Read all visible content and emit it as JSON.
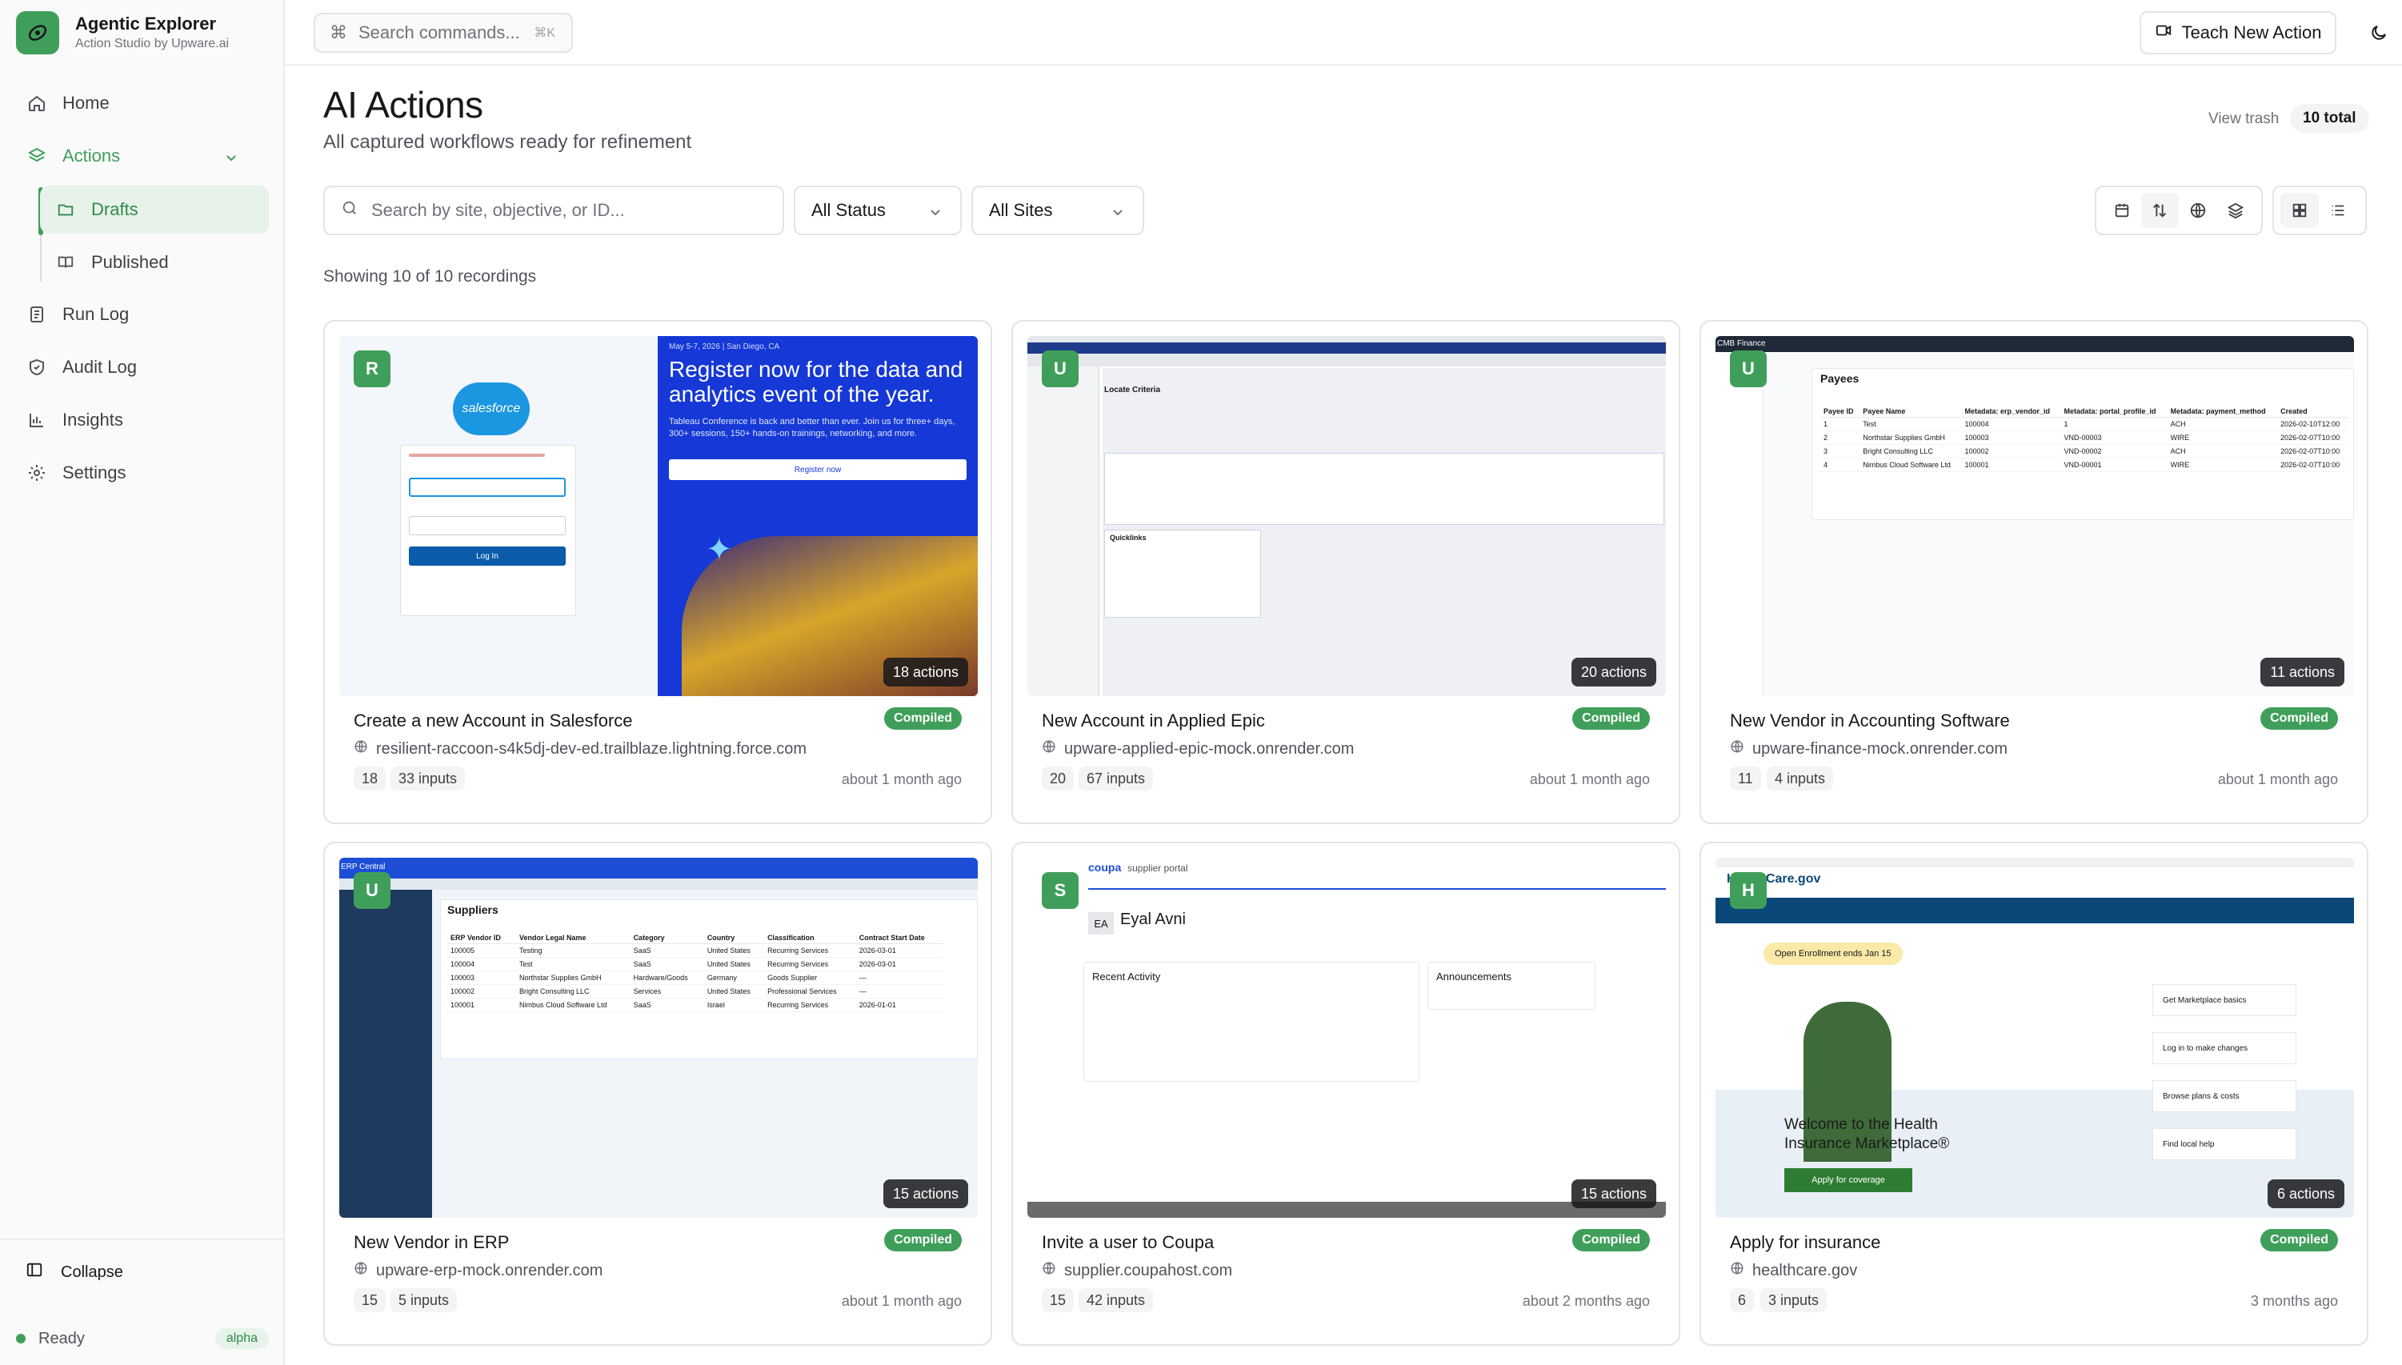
{
  "app": {
    "name": "Agentic Explorer",
    "subtitle": "Action Studio by Upware.ai"
  },
  "sidebar": {
    "items": [
      {
        "label": "Home",
        "icon": "home-icon"
      },
      {
        "label": "Actions",
        "icon": "layers-icon"
      },
      {
        "label": "Drafts",
        "icon": "folder-icon"
      },
      {
        "label": "Published",
        "icon": "book-icon"
      },
      {
        "label": "Run Log",
        "icon": "log-icon"
      },
      {
        "label": "Audit Log",
        "icon": "shield-icon"
      },
      {
        "label": "Insights",
        "icon": "chart-icon"
      },
      {
        "label": "Settings",
        "icon": "gear-icon"
      }
    ],
    "collapse_label": "Collapse",
    "status_label": "Ready",
    "badge": "alpha"
  },
  "topbar": {
    "command_placeholder": "Search commands...",
    "command_shortcut": "⌘K",
    "teach_label": "Teach New Action"
  },
  "header": {
    "title": "AI Actions",
    "subtitle": "All captured workflows ready for refinement",
    "view_trash": "View trash",
    "total": "10 total"
  },
  "filters": {
    "search_placeholder": "Search by site, objective, or ID...",
    "status_value": "All Status",
    "sites_value": "All Sites",
    "showing": "Showing 10 of 10 recordings"
  },
  "colors": {
    "accent": "#3f9f5a",
    "accent_soft": "#e7f3ea"
  },
  "cards": [
    {
      "avatar": "R",
      "actions": "18 actions",
      "title": "Create a new Account in Salesforce",
      "status": "Compiled",
      "site": "resilient-raccoon-s4k5dj-dev-ed.trailblaze.lightning.force.com",
      "count": "18",
      "inputs": "33 inputs",
      "age": "about 1 month ago"
    },
    {
      "avatar": "U",
      "actions": "20 actions",
      "title": "New Account in Applied Epic",
      "status": "Compiled",
      "site": "upware-applied-epic-mock.onrender.com",
      "count": "20",
      "inputs": "67 inputs",
      "age": "about 1 month ago"
    },
    {
      "avatar": "U",
      "actions": "11 actions",
      "title": "New Vendor in Accounting Software",
      "status": "Compiled",
      "site": "upware-finance-mock.onrender.com",
      "count": "11",
      "inputs": "4 inputs",
      "age": "about 1 month ago"
    },
    {
      "avatar": "U",
      "actions": "15 actions",
      "title": "New Vendor in ERP",
      "status": "Compiled",
      "site": "upware-erp-mock.onrender.com",
      "count": "15",
      "inputs": "5 inputs",
      "age": "about 1 month ago"
    },
    {
      "avatar": "S",
      "actions": "15 actions",
      "title": "Invite a user to Coupa",
      "status": "Compiled",
      "site": "supplier.coupahost.com",
      "count": "15",
      "inputs": "42 inputs",
      "age": "about 2 months ago"
    },
    {
      "avatar": "H",
      "actions": "6 actions",
      "title": "Apply for insurance",
      "status": "Compiled",
      "site": "healthcare.gov",
      "count": "6",
      "inputs": "3 inputs",
      "age": "3 months ago"
    }
  ],
  "thumbs": {
    "sf_logo": "salesforce",
    "sf_headline": "Register now for the data and analytics event of the year.",
    "sf_body": "Tableau Conference is back and better than ever. Join us for three+ days, 300+ sessions, 150+ hands-on trainings, networking, and more.",
    "sf_register": "Register now",
    "sf_date": "May 5-7, 2026 | San Diego, CA",
    "sf_login": "Log In",
    "epic_heading": "Locate Criteria",
    "epic_quicklinks": "Quicklinks",
    "fin_brand": "CMB Finance",
    "fin_heading": "Payees",
    "fin_cols": [
      "Payee ID",
      "Payee Name",
      "Metadata: erp_vendor_id",
      "Metadata: portal_profile_id",
      "Metadata: payment_method",
      "Created"
    ],
    "fin_rows": [
      [
        "1",
        "Test",
        "100004",
        "1",
        "ACH",
        "2026-02-10T12:00"
      ],
      [
        "2",
        "Northstar Supplies GmbH",
        "100003",
        "VND-00003",
        "WIRE",
        "2026-02-07T10:00"
      ],
      [
        "3",
        "Bright Consulting LLC",
        "100002",
        "VND-00002",
        "ACH",
        "2026-02-07T10:00"
      ],
      [
        "4",
        "Nimbus Cloud Software Ltd",
        "100001",
        "VND-00001",
        "WIRE",
        "2026-02-07T10:00"
      ]
    ],
    "erp_brand": "ERP Central",
    "erp_heading": "Suppliers",
    "erp_cols": [
      "ERP Vendor ID",
      "Vendor Legal Name",
      "Category",
      "Country",
      "Classification",
      "Contract Start Date"
    ],
    "erp_rows": [
      [
        "100005",
        "Testing",
        "SaaS",
        "United States",
        "Recurring Services",
        "2026-03-01"
      ],
      [
        "100004",
        "Test",
        "SaaS",
        "United States",
        "Recurring Services",
        "2026-03-01"
      ],
      [
        "100003",
        "Northstar Supplies GmbH",
        "Hardware/Goods",
        "Germany",
        "Goods Supplier",
        "—"
      ],
      [
        "100002",
        "Bright Consulting LLC",
        "Services",
        "United States",
        "Professional Services",
        "—"
      ],
      [
        "100001",
        "Nimbus Cloud Software Ltd",
        "SaaS",
        "Israel",
        "Recurring Services",
        "2026-01-01"
      ]
    ],
    "coupa_brand": "coupa",
    "coupa_portal": "supplier portal",
    "coupa_user": "Eyal Avni",
    "coupa_initials": "EA",
    "coupa_activity": "Recent Activity",
    "coupa_announcements": "Announcements",
    "hc_brand": "HealthCare.gov",
    "hc_banner": "Open Enrollment ends Jan 15",
    "hc_welcome": "Welcome to the Health Insurance Marketplace®",
    "hc_apply": "Apply for coverage",
    "hc_links": [
      "Get Marketplace basics",
      "Log in to make changes",
      "Browse plans & costs",
      "Find local help"
    ]
  }
}
